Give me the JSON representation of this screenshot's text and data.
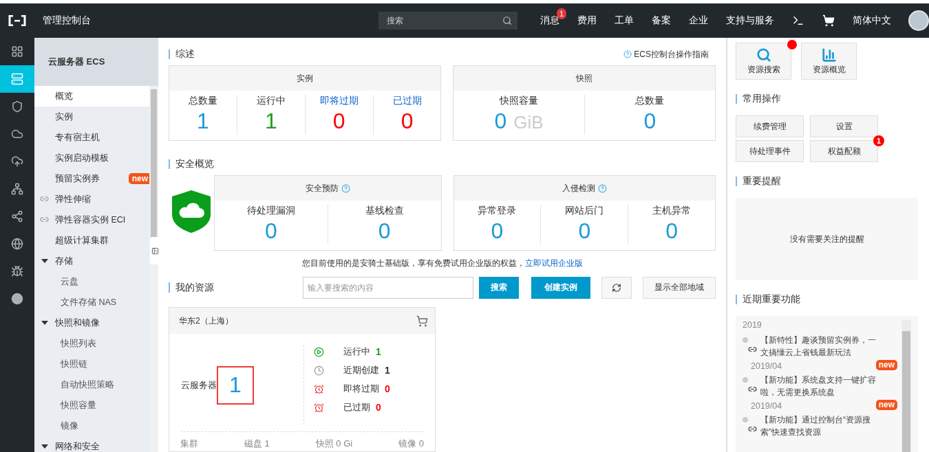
{
  "topbar": {
    "title": "管理控制台",
    "search": {
      "placeholder": "搜索"
    },
    "nav": [
      {
        "label": "消息",
        "badge": "1"
      },
      {
        "label": "费用"
      },
      {
        "label": "工单"
      },
      {
        "label": "备案"
      },
      {
        "label": "企业"
      },
      {
        "label": "支持与服务"
      }
    ],
    "language": "简体中文"
  },
  "rail": [
    {
      "selected": false
    },
    {
      "selected": true
    },
    {
      "selected": false
    },
    {
      "selected": false
    },
    {
      "selected": false
    },
    {
      "selected": false
    },
    {
      "selected": false
    },
    {
      "selected": false
    },
    {
      "selected": false
    },
    {
      "selected": false
    }
  ],
  "sidebar": {
    "title": "云服务器 ECS",
    "items": [
      {
        "label": "概览",
        "selected": true
      },
      {
        "label": "实例",
        "selected": false
      },
      {
        "label": "专有宿主机",
        "selected": false
      },
      {
        "label": "实例启动模板",
        "selected": false
      },
      {
        "label": "预留实例券",
        "selected": false,
        "badge": "new"
      },
      {
        "label": "弹性伸缩",
        "selected": false,
        "kind": "link"
      },
      {
        "label": "弹性容器实例 ECI",
        "selected": false,
        "kind": "link"
      },
      {
        "label": "超级计算集群",
        "selected": false
      },
      {
        "label": "存储",
        "selected": false,
        "expanded": true,
        "children": [
          {
            "label": "云盘",
            "selected": false
          },
          {
            "label": "文件存储 NAS",
            "selected": false
          }
        ]
      },
      {
        "label": "快照和镜像",
        "selected": false,
        "expanded": true,
        "children": [
          {
            "label": "快照列表",
            "selected": false
          },
          {
            "label": "快照链",
            "selected": false
          },
          {
            "label": "自动快照策略",
            "selected": false
          },
          {
            "label": "快照容量",
            "selected": false
          },
          {
            "label": "镜像",
            "selected": false
          }
        ]
      },
      {
        "label": "网络和安全",
        "selected": false,
        "expanded": true
      }
    ]
  },
  "overview": {
    "title": "综述",
    "help_link": "ECS控制台操作指南",
    "cards": [
      {
        "title": "实例",
        "stats": [
          {
            "label": "总数量",
            "value": "1",
            "color": "#1a9bd7"
          },
          {
            "label": "运行中",
            "value": "1",
            "color": "#1e9e1e"
          },
          {
            "label": "即将过期",
            "value": "0",
            "color": "#ff0000",
            "kind": "link"
          },
          {
            "label": "已过期",
            "value": "0",
            "color": "#ff0000",
            "kind": "link"
          }
        ]
      },
      {
        "title": "快照",
        "stats": [
          {
            "label": "快照容量",
            "value": "0",
            "unit": "GiB",
            "color": "#1a9bd7"
          },
          {
            "label": "总数量",
            "value": "0",
            "color": "#1a9bd7"
          }
        ]
      }
    ]
  },
  "security": {
    "title": "安全概览",
    "cards": [
      {
        "title": "安全预防",
        "stats": [
          {
            "label": "待处理漏洞",
            "value": "0",
            "color": "#1a9bd7"
          },
          {
            "label": "基线检查",
            "value": "0",
            "color": "#1a9bd7"
          }
        ]
      },
      {
        "title": "入侵检测",
        "stats": [
          {
            "label": "异常登录",
            "value": "0",
            "color": "#1a9bd7"
          },
          {
            "label": "网站后门",
            "value": "0",
            "color": "#1a9bd7"
          },
          {
            "label": "主机异常",
            "value": "0",
            "color": "#1a9bd7"
          }
        ]
      }
    ],
    "notice": "您目前使用的是安骑士基础版，享有免费试用企业版的权益，",
    "notice_link": "立即试用企业版"
  },
  "resources": {
    "title": "我的资源",
    "search": {
      "placeholder": "输入要搜索的内容"
    },
    "buttons": [
      {
        "label": "搜索",
        "kind": "primary"
      },
      {
        "label": "创建实例",
        "kind": "primary"
      },
      {
        "kind": "refresh"
      },
      {
        "label": "显示全部地域",
        "kind": "default"
      }
    ],
    "region": {
      "title": "华东2（上海）",
      "name": "云服务器",
      "count": "1",
      "highlighted": true,
      "statuses": [
        {
          "label": "运行中",
          "value": "1",
          "kind": "running",
          "color": "#1e9e1e"
        },
        {
          "label": "近期创建",
          "value": "1",
          "kind": "recent",
          "color": "#333333"
        },
        {
          "label": "即将过期",
          "value": "0",
          "kind": "expiring",
          "color": "#ff0000"
        },
        {
          "label": "已过期",
          "value": "0",
          "kind": "expired",
          "color": "#ff0000"
        }
      ],
      "footer": [
        "集群",
        "磁盘 1",
        "快照 0 Gi",
        "镜像 0"
      ]
    }
  },
  "right": {
    "quick": [
      {
        "label": "资源搜索",
        "kind": "search",
        "dot": true
      },
      {
        "label": "资源概览",
        "kind": "chart",
        "dot": false
      }
    ],
    "ops_title": "常用操作",
    "ops": [
      {
        "label": "续费管理"
      },
      {
        "label": "设置"
      },
      {
        "label": "待处理事件"
      },
      {
        "label": "权益配额",
        "badge": "1"
      }
    ],
    "alerts_title": "重要提醒",
    "alerts_empty": "没有需要关注的提醒",
    "features_title": "近期重要功能",
    "year": "2019",
    "features": [
      {
        "text": "【新特性】趣谈预留实例券，一文搞懂云上省钱最新玩法",
        "badge": "new",
        "date": "2019/04"
      },
      {
        "text": "【新功能】系统盘支持一键扩容啦，无需更换系统盘",
        "badge": "new",
        "date": "2019/04"
      },
      {
        "text": "【新功能】通过控制台“资源搜索”快速查找资源"
      }
    ]
  }
}
